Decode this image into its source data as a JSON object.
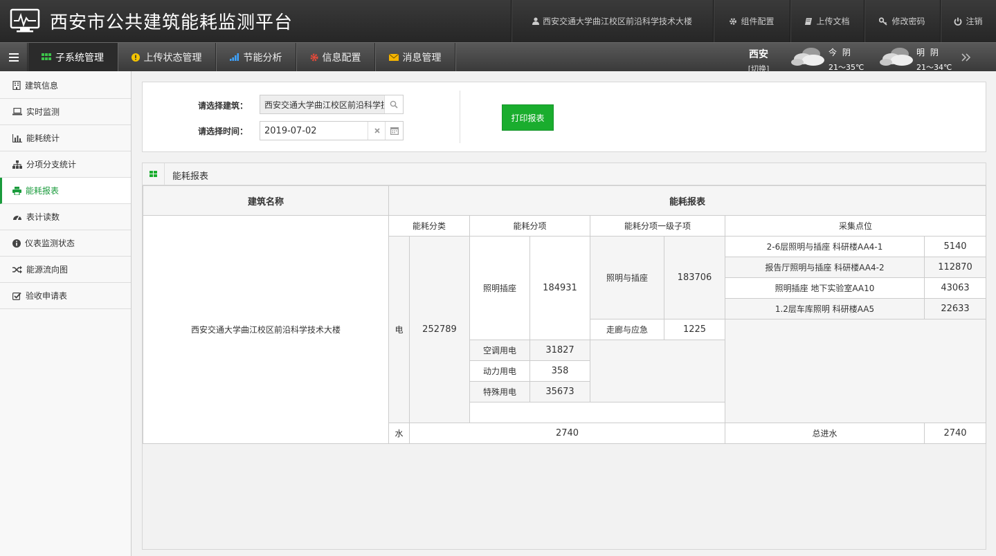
{
  "header": {
    "title": "西安市公共建筑能耗监测平台",
    "nav": {
      "building": "西安交通大学曲江校区前沿科学技术大楼",
      "component_config": "组件配置",
      "upload_docs": "上传文档",
      "change_password": "修改密码",
      "logout": "注销"
    }
  },
  "menu": {
    "tabs": [
      {
        "label": "子系统管理",
        "icon": "grid-icon",
        "color": "#3cc24a"
      },
      {
        "label": "上传状态管理",
        "icon": "alert-circle-icon",
        "color": "#f5c400"
      },
      {
        "label": "节能分析",
        "icon": "signal-bars-icon",
        "color": "#3ea3ff"
      },
      {
        "label": "信息配置",
        "icon": "gear-icon",
        "color": "#e54a3a"
      },
      {
        "label": "消息管理",
        "icon": "envelope-icon",
        "color": "#f5b400"
      }
    ],
    "city": {
      "name": "西安",
      "switch": "[切换]"
    },
    "weather": [
      {
        "day": "今 阴",
        "temp": "21～35℃",
        "icon": "cloud-icon"
      },
      {
        "day": "明 阴",
        "temp": "21～34℃",
        "icon": "cloud-icon"
      }
    ]
  },
  "sidebar": {
    "items": [
      {
        "label": "建筑信息",
        "icon": "building-icon"
      },
      {
        "label": "实时监测",
        "icon": "laptop-icon"
      },
      {
        "label": "能耗统计",
        "icon": "bar-chart-icon"
      },
      {
        "label": "分项分支统计",
        "icon": "sitemap-icon"
      },
      {
        "label": "能耗报表",
        "icon": "print-icon",
        "active": true
      },
      {
        "label": "表计读数",
        "icon": "dashboard-icon"
      },
      {
        "label": "仪表监测状态",
        "icon": "info-circle-icon"
      },
      {
        "label": "能源流向图",
        "icon": "shuffle-icon"
      },
      {
        "label": "验收申请表",
        "icon": "checkbox-icon"
      }
    ]
  },
  "filter": {
    "building_label": "请选择建筑：",
    "building_value": "西安交通大学曲江校区前沿科学技术大楼",
    "time_label": "请选择时间：",
    "time_value": "2019-07-02",
    "print_button": "打印报表"
  },
  "report": {
    "panel_title": "能耗报表",
    "headers": {
      "building_name": "建筑名称",
      "energy_report": "能耗报表",
      "category": "能耗分类",
      "item": "能耗分项",
      "sub_item": "能耗分项一级子项",
      "collection_point": "采集点位"
    },
    "building": "西安交通大学曲江校区前沿科学技术大楼",
    "electric": {
      "label": "电",
      "total": "252789",
      "lighting": {
        "label": "照明插座",
        "value": "184931",
        "sub": [
          {
            "label": "照明与插座",
            "value": "183706",
            "points": [
              {
                "name": "2-6层照明与插座 科研楼AA4-1",
                "value": "5140"
              },
              {
                "name": "报告厅照明与插座 科研楼AA4-2",
                "value": "112870"
              },
              {
                "name": "照明插座 地下实验室AA10",
                "value": "43063"
              },
              {
                "name": "1.2层车库照明 科研楼AA5",
                "value": "22633"
              }
            ]
          },
          {
            "label": "走廊与应急",
            "value": "1225"
          }
        ]
      },
      "others": [
        {
          "label": "空调用电",
          "value": "31827"
        },
        {
          "label": "动力用电",
          "value": "358"
        },
        {
          "label": "特殊用电",
          "value": "35673"
        }
      ]
    },
    "water": {
      "label": "水",
      "total": "2740",
      "point_name": "总进水",
      "point_value": "2740"
    }
  }
}
